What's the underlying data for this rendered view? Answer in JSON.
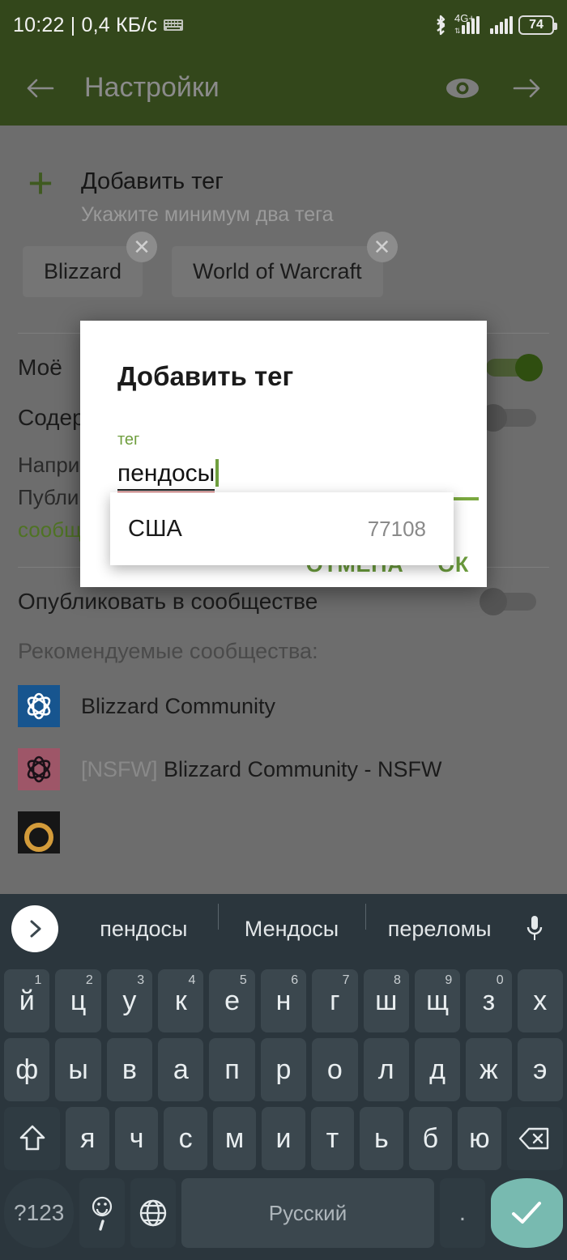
{
  "status_bar": {
    "time_and_speed": "10:22 | 0,4 КБ/с",
    "network_label": "4G+",
    "battery_percent": "74",
    "icons": [
      "keyboard-icon",
      "bluetooth-icon",
      "signal-icon",
      "battery-icon"
    ]
  },
  "toolbar": {
    "title": "Настройки",
    "back_icon": "arrow-left-icon",
    "preview_icon": "eye-icon",
    "next_icon": "arrow-right-icon"
  },
  "page": {
    "add_tag": {
      "plus": "+",
      "title": "Добавить тег",
      "subtitle": "Укажите минимум два тега"
    },
    "tags": [
      {
        "label": "Blizzard",
        "remove": "✕"
      },
      {
        "label": "World of Warcraft",
        "remove": "✕"
      }
    ],
    "settings": [
      {
        "label": "Моё",
        "toggle": "on"
      },
      {
        "label": "Содер",
        "toggle": "off"
      }
    ],
    "hint_line1": "Напри",
    "hint_line2": "Публи",
    "hint_line3": "сообщ",
    "publish_row": {
      "label": "Опубликовать в сообществе",
      "toggle": "off"
    },
    "recommended_title": "Рекомендуемые сообщества:",
    "communities": [
      {
        "prefix": "",
        "name": "Blizzard Community",
        "icon_color": "#17558f"
      },
      {
        "prefix": "[NSFW] ",
        "name": "Blizzard Community - NSFW",
        "icon_color": "#9e5668"
      }
    ]
  },
  "dialog": {
    "title": "Добавить тег",
    "field_label": "тег",
    "input_value": "пендосы",
    "cancel_label": "ОТМЕНА",
    "ok_label": "ОК",
    "suggestion": {
      "name": "США",
      "count": "77108"
    }
  },
  "keyboard": {
    "suggestions": [
      "пендосы",
      "Мендосы",
      "переломы"
    ],
    "expand_icon": "chevron-right-icon",
    "mic_icon": "microphone-icon",
    "row1": [
      {
        "k": "й",
        "n": "1"
      },
      {
        "k": "ц",
        "n": "2"
      },
      {
        "k": "у",
        "n": "3"
      },
      {
        "k": "к",
        "n": "4"
      },
      {
        "k": "е",
        "n": "5"
      },
      {
        "k": "н",
        "n": "6"
      },
      {
        "k": "г",
        "n": "7"
      },
      {
        "k": "ш",
        "n": "8"
      },
      {
        "k": "щ",
        "n": "9"
      },
      {
        "k": "з",
        "n": "0"
      },
      {
        "k": "х",
        "n": ""
      }
    ],
    "row2": [
      "ф",
      "ы",
      "в",
      "а",
      "п",
      "р",
      "о",
      "л",
      "д",
      "ж",
      "э"
    ],
    "row3": [
      "я",
      "ч",
      "с",
      "м",
      "и",
      "т",
      "ь",
      "б",
      "ю"
    ],
    "shift_icon": "shift-icon",
    "backspace_icon": "backspace-icon",
    "symbols_label": "?123",
    "emoji_icon": "emoji-comma-icon",
    "globe_icon": "globe-icon",
    "space_label": "Русский",
    "period_label": ".",
    "enter_icon": "check-icon"
  },
  "colors": {
    "toolbar_green": "#33471b",
    "accent_green": "#6a9a3c",
    "keyboard_bg": "#2b363d",
    "enter_teal": "#78bab0"
  }
}
